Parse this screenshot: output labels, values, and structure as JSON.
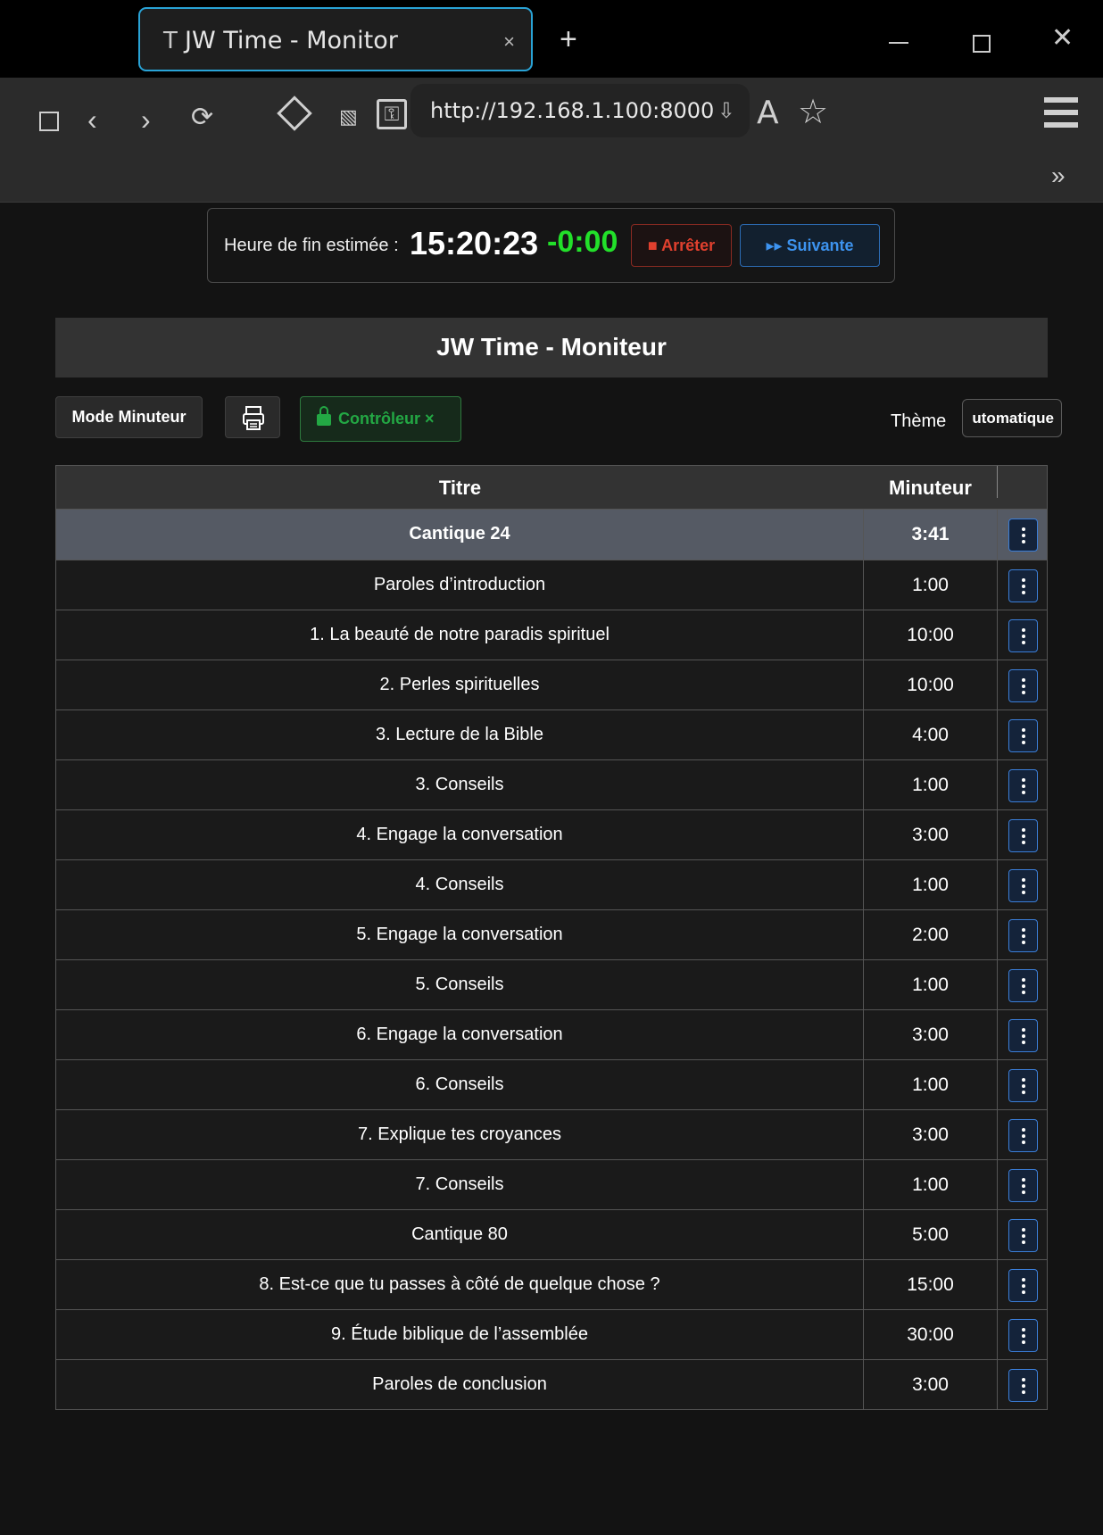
{
  "browser": {
    "tab_favicon": "T",
    "tab_title": "JW Time - Monitor",
    "tab_close": "×",
    "new_tab": "+",
    "window_close": "✕",
    "url": "http://192.168.1.100:8000",
    "toolbar_icons": [
      "sidebar-icon",
      "back-icon",
      "forward-icon",
      "reload-icon",
      "extensions-icon",
      "translate-icon",
      "permissions-icon",
      "download-icon",
      "reader-icon",
      "bookmark-star-icon",
      "menu-icon",
      "overflow-icon"
    ]
  },
  "status": {
    "label": "Heure de fin estimée :",
    "end_time": "15:20:23",
    "delta": "-0:00",
    "stop_label": "■ Arrêter",
    "next_label": "▸▸ Suivante"
  },
  "header": {
    "title": "JW Time - Moniteur"
  },
  "controls": {
    "mode_label": "Mode Minuteur",
    "controller_label": "Contrôleur ×",
    "theme_label": "Thème",
    "theme_value": "utomatique"
  },
  "table": {
    "headers": {
      "title": "Titre",
      "timer": "Minuteur"
    },
    "rows": [
      {
        "title": "Cantique 24",
        "timer": "3:41"
      },
      {
        "title": "Paroles d’introduction",
        "timer": "1:00"
      },
      {
        "title": "1. La beauté de notre paradis spirituel",
        "timer": "10:00"
      },
      {
        "title": "2. Perles spirituelles",
        "timer": "10:00"
      },
      {
        "title": "3. Lecture de la Bible",
        "timer": "4:00"
      },
      {
        "title": "3. Conseils",
        "timer": "1:00"
      },
      {
        "title": "4. Engage la conversation",
        "timer": "3:00"
      },
      {
        "title": "4. Conseils",
        "timer": "1:00"
      },
      {
        "title": "5. Engage la conversation",
        "timer": "2:00"
      },
      {
        "title": "5. Conseils",
        "timer": "1:00"
      },
      {
        "title": "6. Engage la conversation",
        "timer": "3:00"
      },
      {
        "title": "6. Conseils",
        "timer": "1:00"
      },
      {
        "title": "7. Explique tes croyances",
        "timer": "3:00"
      },
      {
        "title": "7. Conseils",
        "timer": "1:00"
      },
      {
        "title": "Cantique 80",
        "timer": "5:00"
      },
      {
        "title": "8. Est-ce que tu passes à côté de quelque chose ?",
        "timer": "15:00"
      },
      {
        "title": "9. Étude biblique de l’assemblée",
        "timer": "30:00"
      },
      {
        "title": "Paroles de conclusion",
        "timer": "3:00"
      }
    ]
  },
  "colors": {
    "accent_blue": "#3d93ef",
    "stop_red": "#e0402e",
    "delta_green": "#22e02a",
    "controller_green": "#23a844",
    "active_row": "#555a64"
  }
}
